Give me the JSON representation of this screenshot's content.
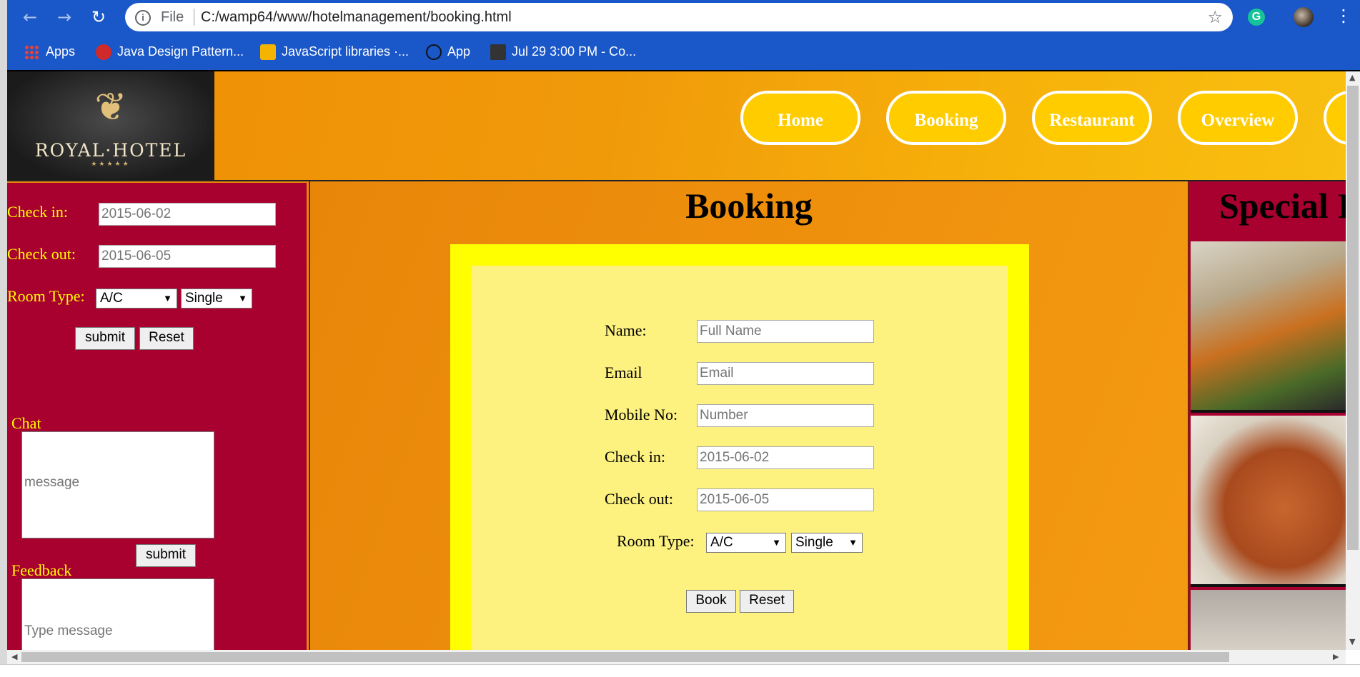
{
  "browser": {
    "file_label": "File",
    "url": "C:/wamp64/www/hotelmanagement/booking.html",
    "bookmarks": [
      {
        "label": "Apps",
        "icon": "apps-grid-icon"
      },
      {
        "label": "Java Design Pattern...",
        "icon": "java-icon"
      },
      {
        "label": "JavaScript libraries ·...",
        "icon": "bookmark-icon"
      },
      {
        "label": "App",
        "icon": "app-icon"
      },
      {
        "label": "Jul 29 3:00 PM - Co...",
        "icon": "calendar-icon"
      }
    ],
    "extension_letter": "G"
  },
  "logo": {
    "text": "ROYAL·HOTEL",
    "stars": "★★★★★"
  },
  "nav": {
    "items": [
      "Home",
      "Booking",
      "Restaurant",
      "Overview"
    ]
  },
  "sidebar": {
    "checkin_label": "Check in:",
    "checkin_value": "2015-06-02",
    "checkout_label": "Check out:",
    "checkout_value": "2015-06-05",
    "roomtype_label": "Room Type:",
    "room_ac": "A/C",
    "room_single": "Single",
    "submit_label": "submit",
    "reset_label": "Reset",
    "chat_label": "Chat",
    "chat_placeholder": "message",
    "chat_submit": "submit",
    "feedback_label": "Feedback",
    "feedback_placeholder": "Type message"
  },
  "booking": {
    "title": "Booking",
    "name_label": "Name:",
    "name_placeholder": "Full Name",
    "email_label": "Email",
    "email_placeholder": "Email",
    "mobile_label": "Mobile No:",
    "mobile_placeholder": "Number",
    "checkin_label": "Check in:",
    "checkin_value": "2015-06-02",
    "checkout_label": "Check out:",
    "checkout_value": "2015-06-05",
    "roomtype_label": "Room Type:",
    "room_ac": "A/C",
    "room_single": "Single",
    "book_label": "Book",
    "reset_label": "Reset"
  },
  "special": {
    "title": "Special I"
  },
  "colors": {
    "header_orange": "#f09a0a",
    "sidebar_crimson": "#a8002f",
    "form_yellow": "#ffff00",
    "form_inner": "#fdf280",
    "nav_pill": "#ffcc00",
    "label_yellow": "#ffff00"
  }
}
